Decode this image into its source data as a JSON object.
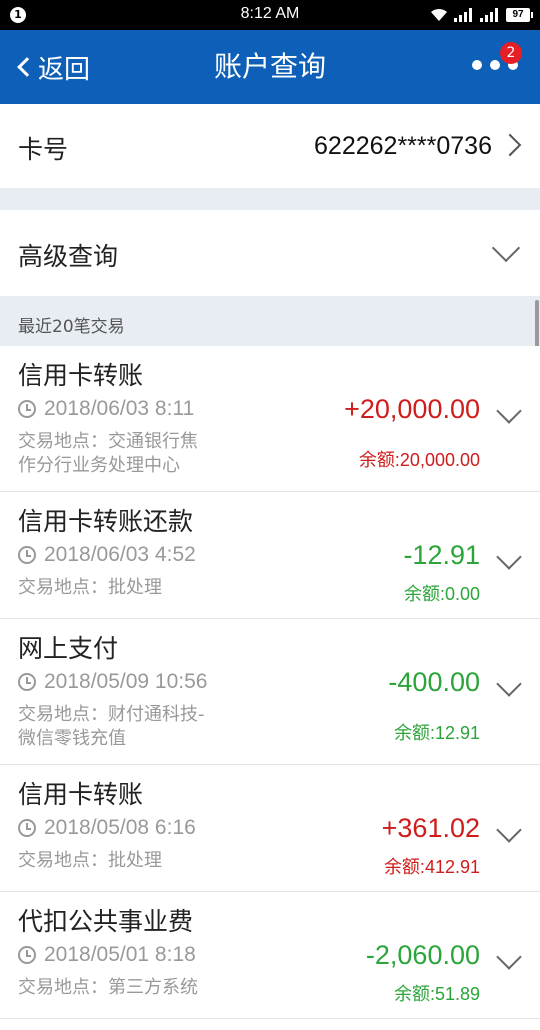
{
  "status_bar": {
    "notification": "1",
    "time": "8:12 AM",
    "battery": "97"
  },
  "nav": {
    "back_label": "返回",
    "title": "账户查询",
    "badge": "2"
  },
  "card": {
    "label": "卡号",
    "number": "622262****0736"
  },
  "advanced": {
    "label": "高级查询"
  },
  "section": {
    "title": "最近20笔交易"
  },
  "transactions": [
    {
      "title": "信用卡转账",
      "datetime": "2018/06/03 8:11",
      "location_line1": "交易地点：交通银行焦",
      "location_line2": "作分行业务处理中心",
      "amount": "+20,000.00",
      "balance": "余额:20,000.00",
      "type": "credit"
    },
    {
      "title": "信用卡转账还款",
      "datetime": "2018/06/03 4:52",
      "location_line1": "交易地点：批处理",
      "location_line2": "",
      "amount": "-12.91",
      "balance": "余额:0.00",
      "type": "debit"
    },
    {
      "title": "网上支付",
      "datetime": "2018/05/09 10:56",
      "location_line1": "交易地点：财付通科技-",
      "location_line2": "微信零钱充值",
      "amount": "-400.00",
      "balance": "余额:12.91",
      "type": "debit"
    },
    {
      "title": "信用卡转账",
      "datetime": "2018/05/08 6:16",
      "location_line1": "交易地点：批处理",
      "location_line2": "",
      "amount": "+361.02",
      "balance": "余额:412.91",
      "type": "credit"
    },
    {
      "title": "代扣公共事业费",
      "datetime": "2018/05/01 8:18",
      "location_line1": "交易地点：第三方系统",
      "location_line2": "",
      "amount": "-2,060.00",
      "balance": "余额:51.89",
      "type": "debit"
    }
  ],
  "colors": {
    "nav_bg": "#0d5fb8",
    "credit": "#cf1c1c",
    "debit": "#2ba53a"
  }
}
